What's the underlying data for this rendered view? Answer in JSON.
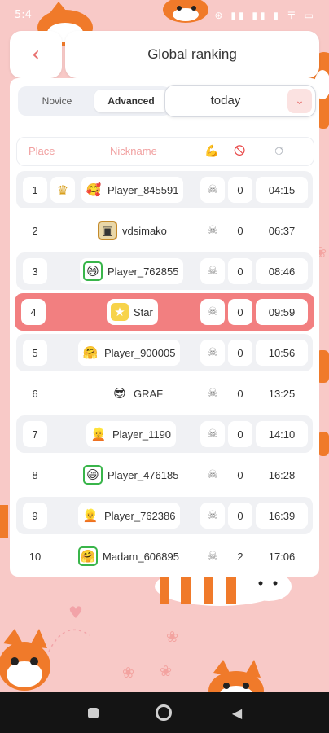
{
  "statusbar": {
    "time": "5:4",
    "icons": "⊛ ▮▮ ▮▮ ▮ 〒 ▭"
  },
  "header": {
    "back_icon": "‹",
    "title": "Global ranking"
  },
  "modes": {
    "novice": "Novice",
    "advanced": "Advanced",
    "selected": "Advanced"
  },
  "period": {
    "value": "today",
    "chevron": "⌄"
  },
  "columns": {
    "place": "Place",
    "nickname": "Nickname",
    "power_icon": "💪",
    "ban_icon": "🛇",
    "timer_icon": "⏱"
  },
  "rows": [
    {
      "place": "1",
      "avatar": "🥰",
      "name": "Player_845591",
      "skull": "☠",
      "score": "0",
      "time": "04:15",
      "crown": "♛"
    },
    {
      "place": "2",
      "avatar": "▣",
      "name": "vdsimako",
      "skull": "☠",
      "score": "0",
      "time": "06:37"
    },
    {
      "place": "3",
      "avatar": "😄",
      "name": "Player_762855",
      "skull": "☠",
      "score": "0",
      "time": "08:46"
    },
    {
      "place": "4",
      "avatar": "★",
      "name": "Star",
      "skull": "☠",
      "score": "0",
      "time": "09:59"
    },
    {
      "place": "5",
      "avatar": "🤗",
      "name": "Player_900005",
      "skull": "☠",
      "score": "0",
      "time": "10:56"
    },
    {
      "place": "6",
      "avatar": "😎",
      "name": "GRAF",
      "skull": "☠",
      "score": "0",
      "time": "13:25"
    },
    {
      "place": "7",
      "avatar": "👱",
      "name": "Player_1190",
      "skull": "☠",
      "score": "0",
      "time": "14:10"
    },
    {
      "place": "8",
      "avatar": "😄",
      "name": "Player_476185",
      "skull": "☠",
      "score": "0",
      "time": "16:28"
    },
    {
      "place": "9",
      "avatar": "👱",
      "name": "Player_762386",
      "skull": "☠",
      "score": "0",
      "time": "16:39"
    },
    {
      "place": "10",
      "avatar": "🤗",
      "name": "Madam_606895",
      "skull": "☠",
      "score": "2",
      "time": "17:06"
    }
  ],
  "nav": {
    "back_icon": "◀"
  },
  "colors": {
    "accent": "#e8706e",
    "highlight_row": "#f27f80",
    "background": "#f8c9c7"
  }
}
